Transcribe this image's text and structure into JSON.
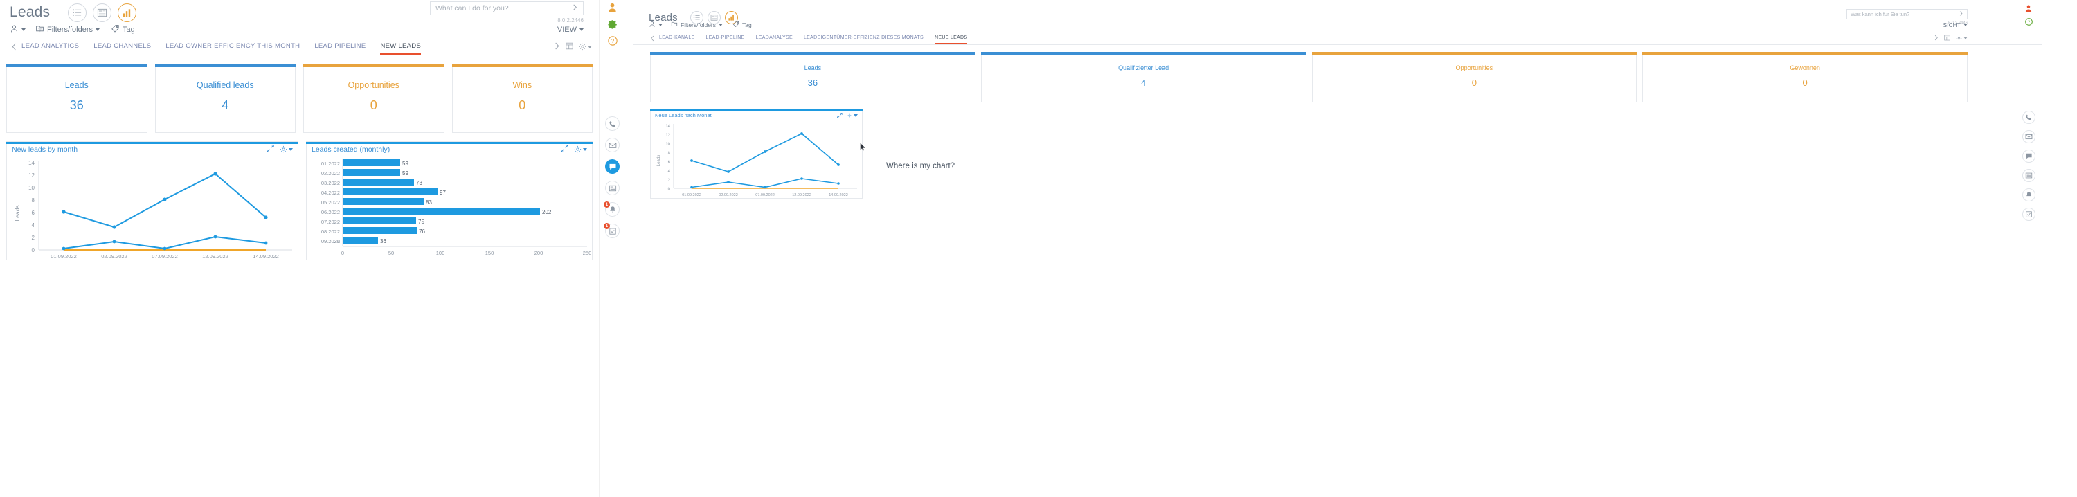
{
  "left": {
    "header": {
      "title": "Leads"
    },
    "view_buttons": [
      {
        "name": "list-view",
        "icon": "list-icon",
        "active": false
      },
      {
        "name": "board-view",
        "icon": "board-icon",
        "active": false
      },
      {
        "name": "chart-view",
        "icon": "chart-bar-icon",
        "active": true
      }
    ],
    "search": {
      "placeholder": "What can I do for you?",
      "value": "What can I do for you?"
    },
    "version": "8.0.2.2446",
    "toolbar": {
      "owner": "",
      "filters": "Filters/folders",
      "tag": "Tag",
      "view": "VIEW"
    },
    "tabs": [
      {
        "label": "LEAD ANALYTICS",
        "active": false
      },
      {
        "label": "LEAD CHANNELS",
        "active": false
      },
      {
        "label": "LEAD OWNER EFFICIENCY THIS MONTH",
        "active": false
      },
      {
        "label": "LEAD PIPELINE",
        "active": false
      },
      {
        "label": "NEW LEADS",
        "active": true
      }
    ],
    "kpis": [
      {
        "label": "Leads",
        "value": "36",
        "color": "#3b8fd4"
      },
      {
        "label": "Qualified leads",
        "value": "4",
        "color": "#3b8fd4"
      },
      {
        "label": "Opportunities",
        "value": "0",
        "color": "#e8a33d"
      },
      {
        "label": "Wins",
        "value": "0",
        "color": "#e8a33d"
      }
    ],
    "widgets": [
      {
        "title": "New leads by month"
      },
      {
        "title": "Leads created (monthly)"
      }
    ]
  },
  "right": {
    "header": {
      "title": "Leads"
    },
    "search": {
      "placeholder": "Was kann ich fur Sie tun?",
      "value": "Was kann ich fur Sie tun?"
    },
    "version": "8.0.2.2446",
    "toolbar": {
      "filters": "Filters/folders",
      "tag": "Tag",
      "view": "SICHT"
    },
    "tabs": [
      {
        "label": "LEAD-KANÄLE",
        "active": false
      },
      {
        "label": "LEAD-PIPELINE",
        "active": false
      },
      {
        "label": "LEADANALYSE",
        "active": false
      },
      {
        "label": "LEADEIGENTÜMER-EFFIZIENZ DIESES MONATS",
        "active": false
      },
      {
        "label": "NEUE LEADS",
        "active": true
      }
    ],
    "kpis": [
      {
        "label": "Leads",
        "value": "36",
        "color": "#3b8fd4"
      },
      {
        "label": "Qualifizierter Lead",
        "value": "4",
        "color": "#3b8fd4"
      },
      {
        "label": "Opportunities",
        "value": "0",
        "color": "#e8a33d"
      },
      {
        "label": "Gewonnen",
        "value": "0",
        "color": "#e8a33d"
      }
    ],
    "widgets": [
      {
        "title": "Neue Leads nach Monat"
      }
    ],
    "annotation": "Where is my chart?"
  },
  "rails": {
    "center": [
      {
        "icon": "user-avatar-icon",
        "style": "plain"
      },
      {
        "icon": "settings-gear-icon",
        "style": "plain"
      },
      {
        "icon": "help-circle-icon",
        "style": "plain"
      },
      {
        "icon": "phone-icon",
        "style": "circled"
      },
      {
        "icon": "mail-icon",
        "style": "circled"
      },
      {
        "icon": "chat-icon",
        "style": "blue"
      },
      {
        "icon": "news-icon",
        "style": "circled"
      },
      {
        "icon": "bell-icon",
        "style": "circled",
        "badge": "1"
      },
      {
        "icon": "task-icon",
        "style": "circled",
        "badge": "1"
      }
    ],
    "right": [
      {
        "icon": "user-avatar-icon",
        "style": "plain"
      },
      {
        "icon": "help-circle-icon",
        "style": "plain"
      },
      {
        "icon": "phone-icon",
        "style": "circled"
      },
      {
        "icon": "mail-icon",
        "style": "circled"
      },
      {
        "icon": "chat-icon",
        "style": "circled"
      },
      {
        "icon": "news-icon",
        "style": "circled"
      },
      {
        "icon": "bell-icon",
        "style": "circled"
      },
      {
        "icon": "task-icon",
        "style": "circled"
      }
    ]
  },
  "chart_data": [
    {
      "id": "left-line",
      "type": "line",
      "title": "New leads by month",
      "xlabel": "",
      "ylabel": "Leads",
      "categories": [
        "01.09.2022",
        "02.09.2022",
        "07.09.2022",
        "12.09.2022",
        "14.09.2022"
      ],
      "yticks": [
        0,
        2,
        4,
        6,
        8,
        10,
        12,
        14
      ],
      "ylim": [
        0,
        14
      ],
      "grid": false,
      "legend": "none",
      "series": [
        {
          "name": "Leads",
          "color": "#1e9ae0",
          "values": [
            6,
            3.6,
            8,
            13,
            5.2
          ]
        },
        {
          "name": "Qualified leads",
          "color": "#1e9ae0",
          "values": [
            0.2,
            1.3,
            0.2,
            2.1,
            1.1
          ]
        },
        {
          "name": "Opportunities",
          "color": "#f0a62a",
          "values": [
            0,
            0,
            0,
            0,
            0
          ]
        }
      ]
    },
    {
      "id": "left-bar",
      "type": "bar",
      "orientation": "horizontal",
      "title": "Leads created (monthly)",
      "xlabel": "",
      "ylabel": "",
      "categories": [
        "01.2022",
        "02.2022",
        "03.2022",
        "04.2022",
        "05.2022",
        "06.2022",
        "07.2022",
        "08.2022",
        "09.2022"
      ],
      "values": [
        59,
        59,
        73,
        97,
        83,
        202,
        75,
        76,
        36
      ],
      "xticks": [
        0,
        50,
        100,
        150,
        200,
        250
      ],
      "xlim": [
        0,
        250
      ],
      "color": "#1e9ae0",
      "grid": false
    },
    {
      "id": "right-line",
      "type": "line",
      "title": "Neue Leads nach Monat",
      "xlabel": "",
      "ylabel": "Leads",
      "categories": [
        "01.09.2022",
        "02.09.2022",
        "07.09.2022",
        "12.09.2022",
        "14.09.2022"
      ],
      "yticks": [
        0,
        2,
        4,
        6,
        8,
        10,
        12,
        14
      ],
      "ylim": [
        0,
        14
      ],
      "grid": false,
      "legend": "none",
      "series": [
        {
          "name": "Leads",
          "color": "#1e9ae0",
          "values": [
            6,
            3.6,
            8,
            13,
            5.2
          ]
        },
        {
          "name": "Qualifizierter Lead",
          "color": "#1e9ae0",
          "values": [
            0.2,
            1.3,
            0.2,
            2.1,
            1.1
          ]
        },
        {
          "name": "Opportunities",
          "color": "#f0a62a",
          "values": [
            0,
            0,
            0,
            0,
            0
          ]
        }
      ]
    }
  ]
}
